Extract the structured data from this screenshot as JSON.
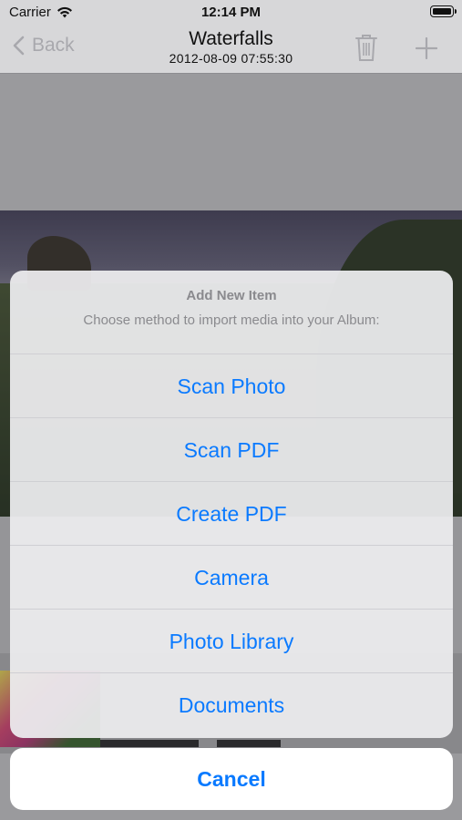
{
  "status_bar": {
    "carrier": "Carrier",
    "time": "12:14 PM"
  },
  "nav": {
    "back_label": "Back",
    "title": "Waterfalls",
    "subtitle": "2012-08-09 07:55:30"
  },
  "icons": {
    "back": "chevron-left-icon",
    "trash": "trash-icon",
    "add": "plus-icon",
    "wifi": "wifi-icon",
    "battery": "battery-icon"
  },
  "action_sheet": {
    "title": "Add New Item",
    "message": "Choose method to import media into your Album:",
    "actions": [
      "Scan Photo",
      "Scan PDF",
      "Create PDF",
      "Camera",
      "Photo Library",
      "Documents"
    ],
    "cancel_label": "Cancel"
  },
  "colors": {
    "accent": "#0a7aff",
    "sheet_text": "#8a8a8e"
  }
}
